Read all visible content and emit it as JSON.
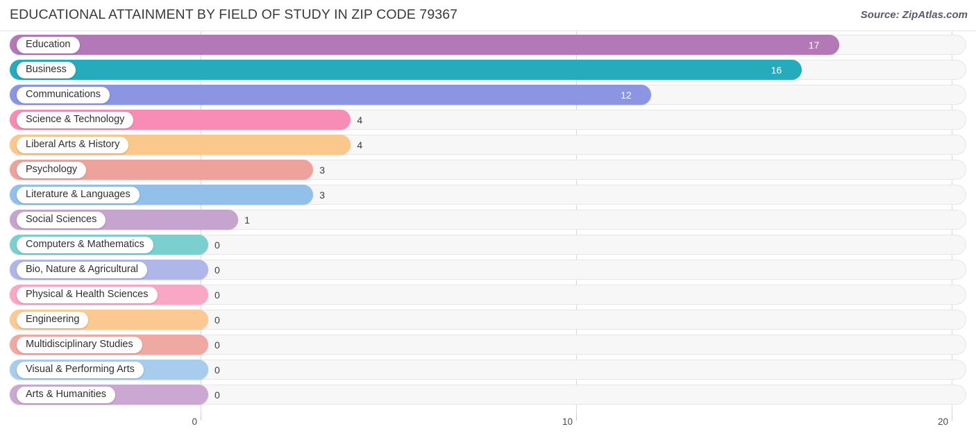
{
  "header": {
    "title": "EDUCATIONAL ATTAINMENT BY FIELD OF STUDY IN ZIP CODE 79367",
    "source": "Source: ZipAtlas.com"
  },
  "chart_data": {
    "type": "bar",
    "orientation": "horizontal",
    "title": "EDUCATIONAL ATTAINMENT BY FIELD OF STUDY IN ZIP CODE 79367",
    "xlabel": "",
    "ylabel": "",
    "xlim": [
      0,
      20
    ],
    "xticks": [
      0,
      10,
      20
    ],
    "xtick_labels": [
      "0",
      "10",
      "20"
    ],
    "grid": true,
    "legend": false,
    "categories": [
      "Education",
      "Business",
      "Communications",
      "Science & Technology",
      "Liberal Arts & History",
      "Psychology",
      "Literature & Languages",
      "Social Sciences",
      "Computers & Mathematics",
      "Bio, Nature & Agricultural",
      "Physical & Health Sciences",
      "Engineering",
      "Multidisciplinary Studies",
      "Visual & Performing Arts",
      "Arts & Humanities"
    ],
    "values": [
      17,
      16,
      12,
      4,
      4,
      3,
      3,
      1,
      0,
      0,
      0,
      0,
      0,
      0,
      0
    ],
    "value_labels": [
      "17",
      "16",
      "12",
      "4",
      "4",
      "3",
      "3",
      "1",
      "0",
      "0",
      "0",
      "0",
      "0",
      "0",
      "0"
    ],
    "colors": [
      "#b279b6",
      "#26abbd",
      "#8b95e2",
      "#f78cb4",
      "#fbc88b",
      "#eda39c",
      "#93c0e8",
      "#c5a4cd",
      "#7ccfcf",
      "#afb7e8",
      "#f9a7c4",
      "#fcc993",
      "#efa9a2",
      "#a7cced",
      "#cba8d2"
    ]
  },
  "axis": {
    "ticks": [
      {
        "label": "0"
      },
      {
        "label": "10"
      },
      {
        "label": "20"
      }
    ]
  }
}
